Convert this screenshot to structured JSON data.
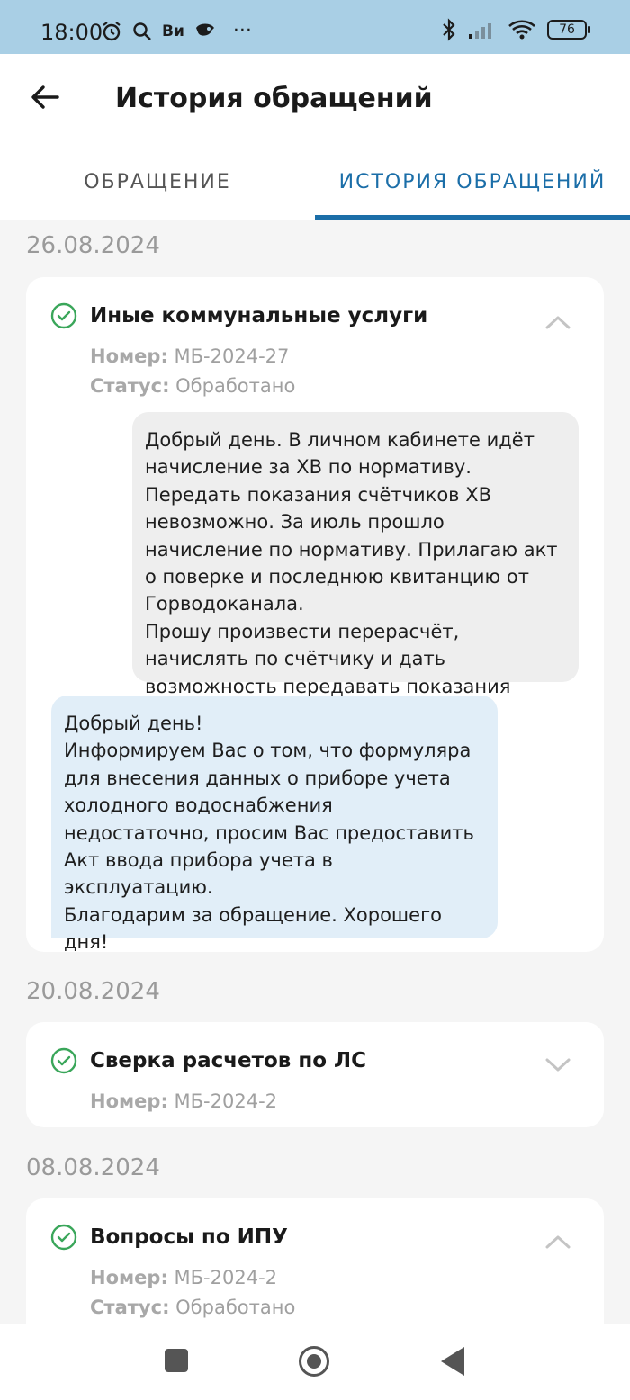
{
  "status_bar": {
    "time": "18:00",
    "carrier_short": "Ви",
    "more": "···",
    "battery": "76"
  },
  "header": {
    "title": "История обращений"
  },
  "tabs": [
    {
      "label": "ОБРАЩЕНИЕ",
      "active": false
    },
    {
      "label": "ИСТОРИЯ ОБРАЩЕНИЙ",
      "active": true
    }
  ],
  "meta_labels": {
    "number": "Номер:",
    "status": "Статус:"
  },
  "groups": [
    {
      "date": "26.08.2024",
      "title": "Иные коммунальные услуги",
      "number": "МБ-2024-27",
      "status": "Обработано",
      "expanded": true,
      "messages": {
        "user": "Добрый день. В личном кабинете идёт начисление за ХВ по нормативу. Передать показания счётчиков ХВ невозможно. За июль прошло начисление по нормативу. Прилагаю акт о поверке и последнюю квитанцию от Горводоканала.\nПрошу произвести перерасчёт, начислять по счётчику  и дать возможность передавать показания счётчика ХВ.",
        "reply": "Добрый день!\nИнформируем Вас о том, что формуляра для  внесения данных о приборе учета холодного водоснабжения недостаточно, просим Вас предоставить Акт ввода прибора учета в эксплуатацию.\nБлагодарим за обращение. Хорошего дня!"
      }
    },
    {
      "date": "20.08.2024",
      "title": "Сверка расчетов по ЛС",
      "number": "МБ-2024-2",
      "expanded": false
    },
    {
      "date": "08.08.2024",
      "title": "Вопросы по ИПУ",
      "number": "МБ-2024-2",
      "status": "Обработано",
      "expanded": true
    }
  ],
  "colors": {
    "accent": "#1b6ea8",
    "status_bar": "#a9cfe5",
    "check": "#3aa65a",
    "reply_bubble": "#e1eef8",
    "user_bubble": "#eeeeee"
  }
}
